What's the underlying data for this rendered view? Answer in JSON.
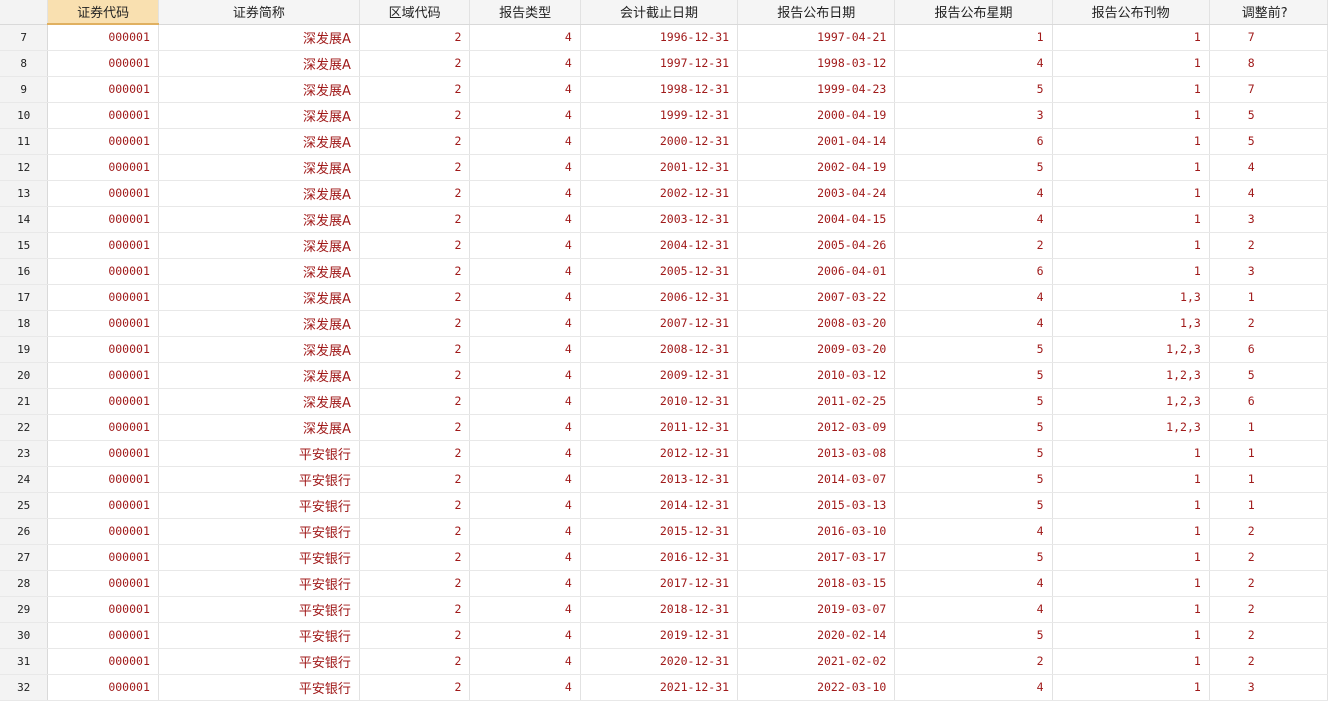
{
  "columns": [
    "证券代码",
    "证券简称",
    "区域代码",
    "报告类型",
    "会计截止日期",
    "报告公布日期",
    "报告公布星期",
    "报告公布刊物",
    "调整前?"
  ],
  "rows": [
    {
      "n": "7",
      "code": "000001",
      "name": "深发展A",
      "region": "2",
      "type": "4",
      "acc": "1996-12-31",
      "pub": "1997-04-21",
      "wk": "1",
      "journal": "1",
      "adj": "7"
    },
    {
      "n": "8",
      "code": "000001",
      "name": "深发展A",
      "region": "2",
      "type": "4",
      "acc": "1997-12-31",
      "pub": "1998-03-12",
      "wk": "4",
      "journal": "1",
      "adj": "8"
    },
    {
      "n": "9",
      "code": "000001",
      "name": "深发展A",
      "region": "2",
      "type": "4",
      "acc": "1998-12-31",
      "pub": "1999-04-23",
      "wk": "5",
      "journal": "1",
      "adj": "7"
    },
    {
      "n": "10",
      "code": "000001",
      "name": "深发展A",
      "region": "2",
      "type": "4",
      "acc": "1999-12-31",
      "pub": "2000-04-19",
      "wk": "3",
      "journal": "1",
      "adj": "5"
    },
    {
      "n": "11",
      "code": "000001",
      "name": "深发展A",
      "region": "2",
      "type": "4",
      "acc": "2000-12-31",
      "pub": "2001-04-14",
      "wk": "6",
      "journal": "1",
      "adj": "5"
    },
    {
      "n": "12",
      "code": "000001",
      "name": "深发展A",
      "region": "2",
      "type": "4",
      "acc": "2001-12-31",
      "pub": "2002-04-19",
      "wk": "5",
      "journal": "1",
      "adj": "4"
    },
    {
      "n": "13",
      "code": "000001",
      "name": "深发展A",
      "region": "2",
      "type": "4",
      "acc": "2002-12-31",
      "pub": "2003-04-24",
      "wk": "4",
      "journal": "1",
      "adj": "4"
    },
    {
      "n": "14",
      "code": "000001",
      "name": "深发展A",
      "region": "2",
      "type": "4",
      "acc": "2003-12-31",
      "pub": "2004-04-15",
      "wk": "4",
      "journal": "1",
      "adj": "3"
    },
    {
      "n": "15",
      "code": "000001",
      "name": "深发展A",
      "region": "2",
      "type": "4",
      "acc": "2004-12-31",
      "pub": "2005-04-26",
      "wk": "2",
      "journal": "1",
      "adj": "2"
    },
    {
      "n": "16",
      "code": "000001",
      "name": "深发展A",
      "region": "2",
      "type": "4",
      "acc": "2005-12-31",
      "pub": "2006-04-01",
      "wk": "6",
      "journal": "1",
      "adj": "3"
    },
    {
      "n": "17",
      "code": "000001",
      "name": "深发展A",
      "region": "2",
      "type": "4",
      "acc": "2006-12-31",
      "pub": "2007-03-22",
      "wk": "4",
      "journal": "1,3",
      "adj": "1"
    },
    {
      "n": "18",
      "code": "000001",
      "name": "深发展A",
      "region": "2",
      "type": "4",
      "acc": "2007-12-31",
      "pub": "2008-03-20",
      "wk": "4",
      "journal": "1,3",
      "adj": "2"
    },
    {
      "n": "19",
      "code": "000001",
      "name": "深发展A",
      "region": "2",
      "type": "4",
      "acc": "2008-12-31",
      "pub": "2009-03-20",
      "wk": "5",
      "journal": "1,2,3",
      "adj": "6"
    },
    {
      "n": "20",
      "code": "000001",
      "name": "深发展A",
      "region": "2",
      "type": "4",
      "acc": "2009-12-31",
      "pub": "2010-03-12",
      "wk": "5",
      "journal": "1,2,3",
      "adj": "5"
    },
    {
      "n": "21",
      "code": "000001",
      "name": "深发展A",
      "region": "2",
      "type": "4",
      "acc": "2010-12-31",
      "pub": "2011-02-25",
      "wk": "5",
      "journal": "1,2,3",
      "adj": "6"
    },
    {
      "n": "22",
      "code": "000001",
      "name": "深发展A",
      "region": "2",
      "type": "4",
      "acc": "2011-12-31",
      "pub": "2012-03-09",
      "wk": "5",
      "journal": "1,2,3",
      "adj": "1"
    },
    {
      "n": "23",
      "code": "000001",
      "name": "平安银行",
      "region": "2",
      "type": "4",
      "acc": "2012-12-31",
      "pub": "2013-03-08",
      "wk": "5",
      "journal": "1",
      "adj": "1"
    },
    {
      "n": "24",
      "code": "000001",
      "name": "平安银行",
      "region": "2",
      "type": "4",
      "acc": "2013-12-31",
      "pub": "2014-03-07",
      "wk": "5",
      "journal": "1",
      "adj": "1"
    },
    {
      "n": "25",
      "code": "000001",
      "name": "平安银行",
      "region": "2",
      "type": "4",
      "acc": "2014-12-31",
      "pub": "2015-03-13",
      "wk": "5",
      "journal": "1",
      "adj": "1"
    },
    {
      "n": "26",
      "code": "000001",
      "name": "平安银行",
      "region": "2",
      "type": "4",
      "acc": "2015-12-31",
      "pub": "2016-03-10",
      "wk": "4",
      "journal": "1",
      "adj": "2"
    },
    {
      "n": "27",
      "code": "000001",
      "name": "平安银行",
      "region": "2",
      "type": "4",
      "acc": "2016-12-31",
      "pub": "2017-03-17",
      "wk": "5",
      "journal": "1",
      "adj": "2"
    },
    {
      "n": "28",
      "code": "000001",
      "name": "平安银行",
      "region": "2",
      "type": "4",
      "acc": "2017-12-31",
      "pub": "2018-03-15",
      "wk": "4",
      "journal": "1",
      "adj": "2"
    },
    {
      "n": "29",
      "code": "000001",
      "name": "平安银行",
      "region": "2",
      "type": "4",
      "acc": "2018-12-31",
      "pub": "2019-03-07",
      "wk": "4",
      "journal": "1",
      "adj": "2"
    },
    {
      "n": "30",
      "code": "000001",
      "name": "平安银行",
      "region": "2",
      "type": "4",
      "acc": "2019-12-31",
      "pub": "2020-02-14",
      "wk": "5",
      "journal": "1",
      "adj": "2"
    },
    {
      "n": "31",
      "code": "000001",
      "name": "平安银行",
      "region": "2",
      "type": "4",
      "acc": "2020-12-31",
      "pub": "2021-02-02",
      "wk": "2",
      "journal": "1",
      "adj": "2"
    },
    {
      "n": "32",
      "code": "000001",
      "name": "平安银行",
      "region": "2",
      "type": "4",
      "acc": "2021-12-31",
      "pub": "2022-03-10",
      "wk": "4",
      "journal": "1",
      "adj": "3"
    }
  ]
}
